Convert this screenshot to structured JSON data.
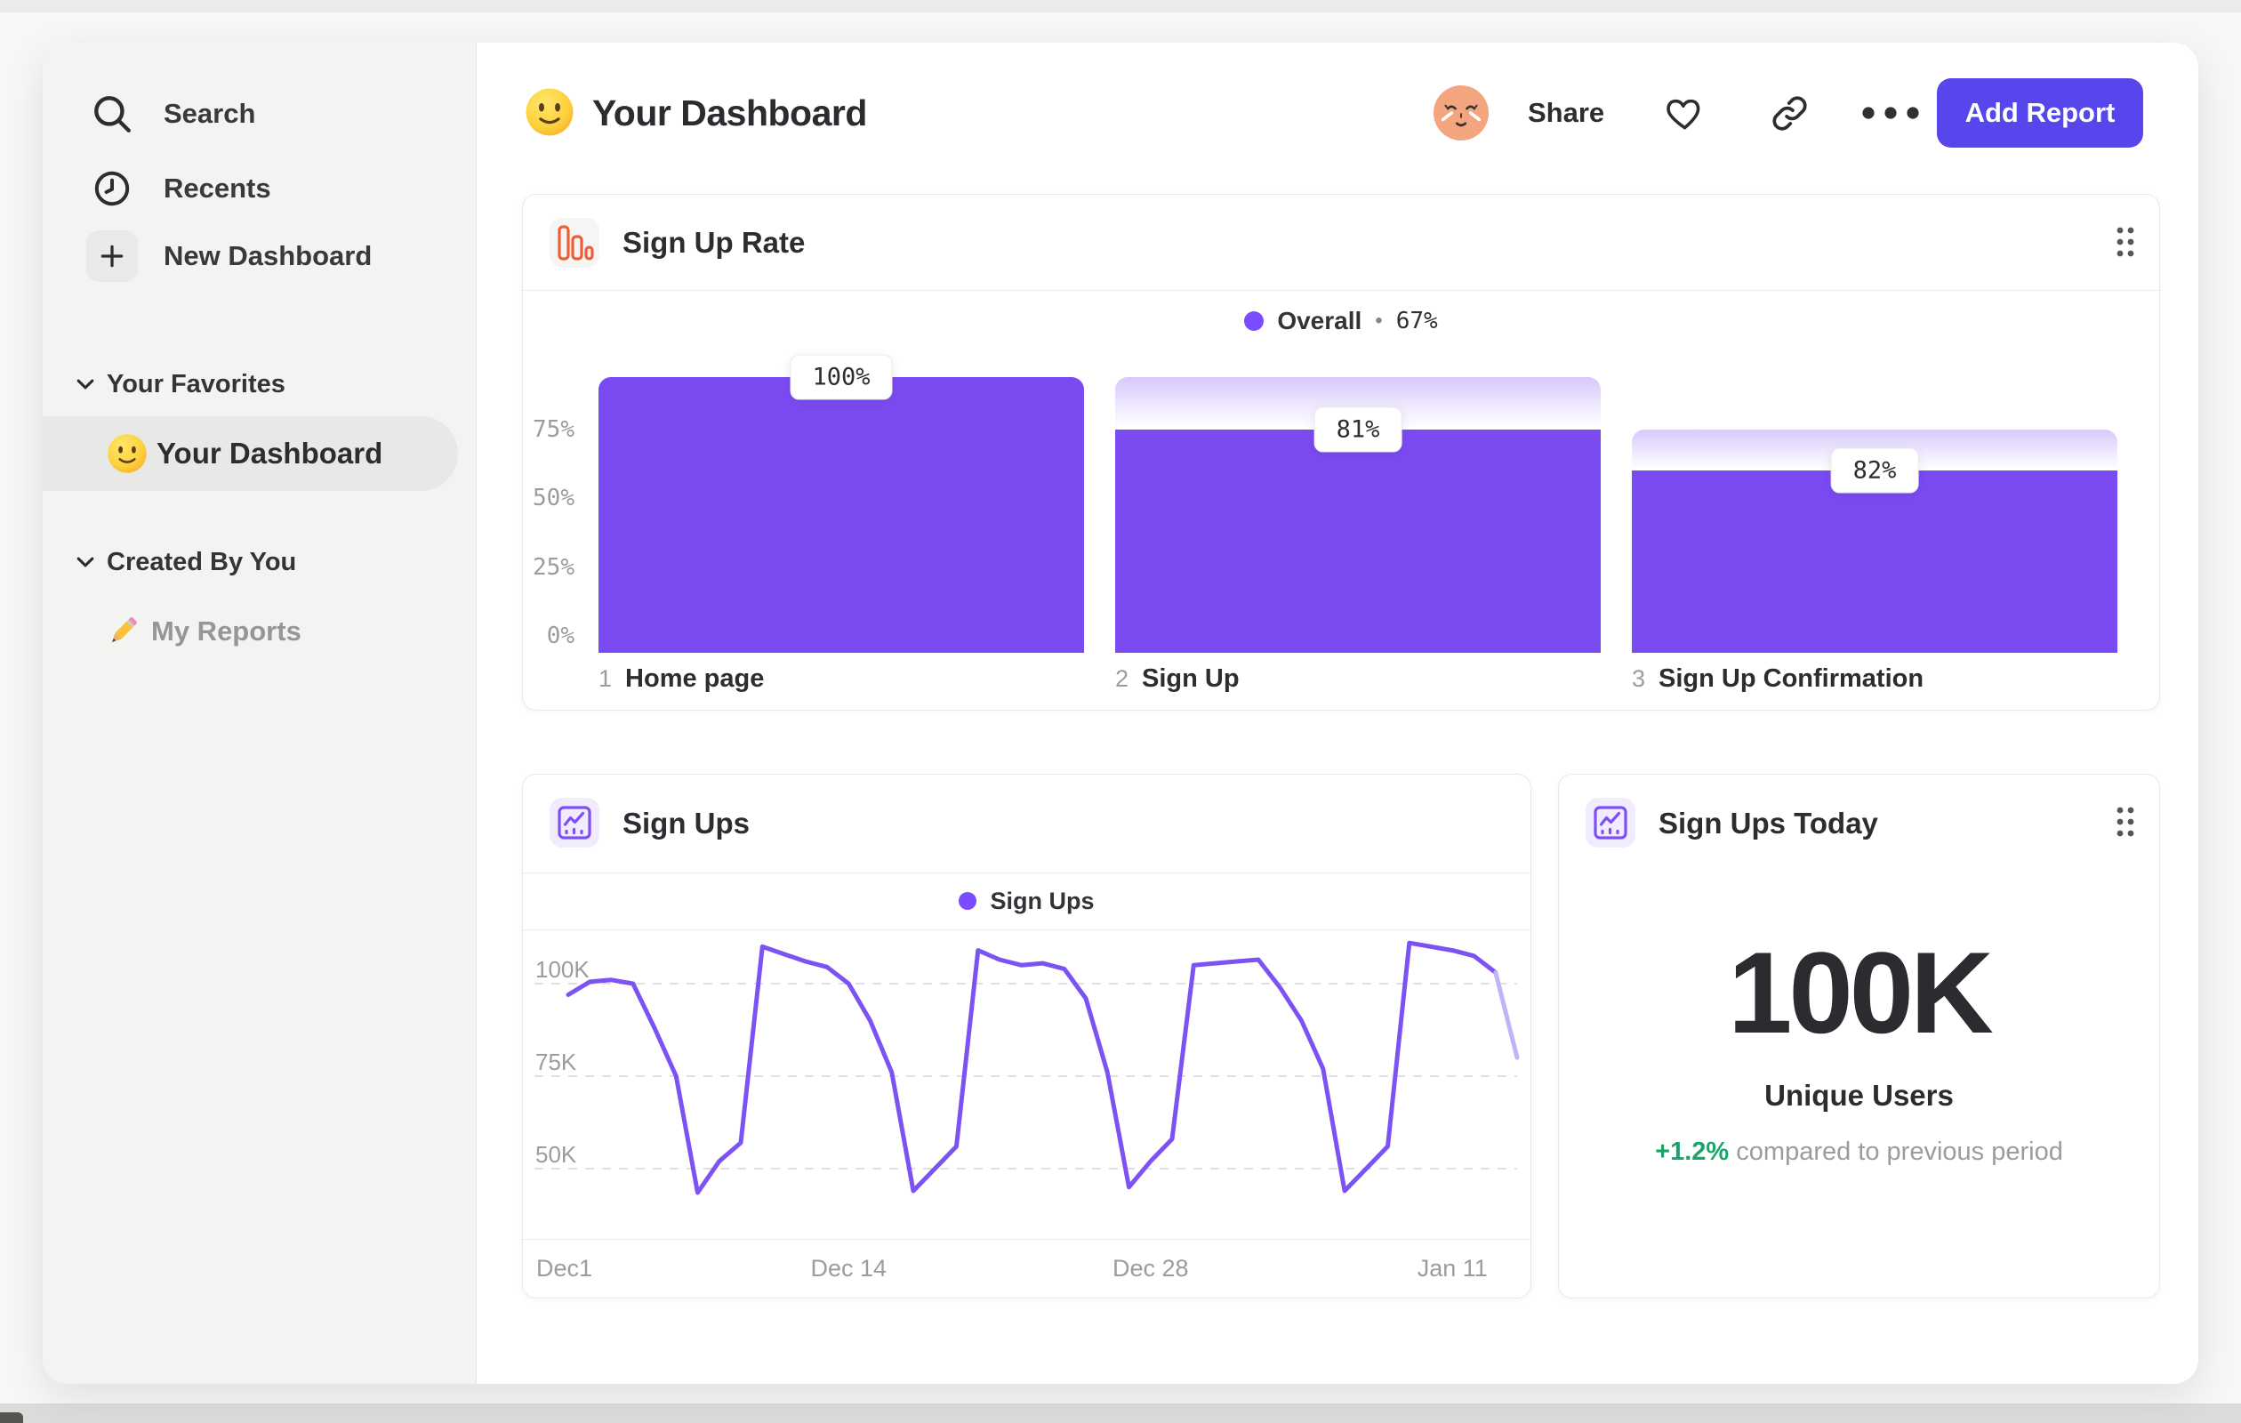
{
  "colors": {
    "accent_purple": "#7b4bf2",
    "line_purple": "#7c52f3",
    "faded_line": "#c3b2f8",
    "legend_dot": "#7c4dff",
    "button": "#5646ec",
    "green": "#18a567",
    "orange_icon": "#ec5f38",
    "purple_icon": "#7e4ff5"
  },
  "sidebar": {
    "items": [
      {
        "label": "Search",
        "icon": "search"
      },
      {
        "label": "Recents",
        "icon": "clock"
      },
      {
        "label": "New Dashboard",
        "icon": "plus"
      }
    ],
    "sections": [
      {
        "label": "Your Favorites",
        "items": [
          {
            "label": "Your Dashboard",
            "emoji": "slightly-smiling-face",
            "selected": true
          }
        ]
      },
      {
        "label": "Created By You",
        "items": [
          {
            "label": "My Reports",
            "emoji": "pencil",
            "selected": false
          }
        ]
      }
    ]
  },
  "header": {
    "emoji": "slightly-smiling-face",
    "title": "Your Dashboard",
    "share_label": "Share",
    "add_report_label": "Add Report"
  },
  "cards": {
    "funnel": {
      "title": "Sign Up Rate"
    },
    "line": {
      "title": "Sign Ups"
    },
    "kpi": {
      "title": "Sign Ups Today",
      "value": "100K",
      "metric": "Unique Users",
      "delta": "+1.2%",
      "delta_note": "compared to previous period"
    }
  },
  "chart_data": [
    {
      "type": "bar",
      "subtype": "funnel",
      "title": "Sign Up Rate",
      "legend": {
        "name": "Overall",
        "separator": "•",
        "value": "67%"
      },
      "ylim": [
        0,
        100
      ],
      "y_axis": [
        {
          "label": "75%",
          "value": 75
        },
        {
          "label": "50%",
          "value": 50
        },
        {
          "label": "25%",
          "value": 25
        },
        {
          "label": "0%",
          "value": 0
        }
      ],
      "steps": [
        {
          "number": "1",
          "label": "Home page",
          "conversion": "100%",
          "height_pct": 100,
          "gradient_top_pct": null
        },
        {
          "number": "2",
          "label": "Sign Up",
          "conversion": "81%",
          "height_pct": 81,
          "gradient_top_pct": 100
        },
        {
          "number": "3",
          "label": "Sign Up Confirmation",
          "conversion": "82%",
          "height_pct": 66,
          "gradient_top_pct": 81
        }
      ]
    },
    {
      "type": "line",
      "title": "Sign Ups",
      "legend": {
        "name": "Sign Ups"
      },
      "unit": "K",
      "grid": "dashed-horizontal",
      "legend_position": "top-center",
      "ylim_k": [
        31,
        114
      ],
      "yticks": [
        {
          "label": "100K",
          "value": 100
        },
        {
          "label": "75K",
          "value": 75
        },
        {
          "label": "50K",
          "value": 50
        }
      ],
      "x_ticks": [
        {
          "label": "Dec1",
          "idx": 0,
          "align": "left"
        },
        {
          "label": "Dec 14",
          "idx": 13
        },
        {
          "label": "Dec 28",
          "idx": 27
        },
        {
          "label": "Jan 11",
          "idx": 41
        }
      ],
      "series": [
        {
          "name": "Sign Ups",
          "values_k": [
            97,
            100.5,
            101,
            100,
            88,
            75,
            43.5,
            52,
            57,
            110,
            108,
            106,
            104.5,
            100,
            90,
            76,
            44,
            50,
            56,
            109,
            106.5,
            105,
            105.5,
            104,
            96,
            76,
            45,
            52,
            58,
            105,
            105.5,
            106,
            106.5,
            99,
            90,
            77,
            44,
            50,
            56,
            111,
            110,
            109,
            107.5,
            103,
            80
          ]
        }
      ],
      "fade_from_index": 43
    }
  ]
}
